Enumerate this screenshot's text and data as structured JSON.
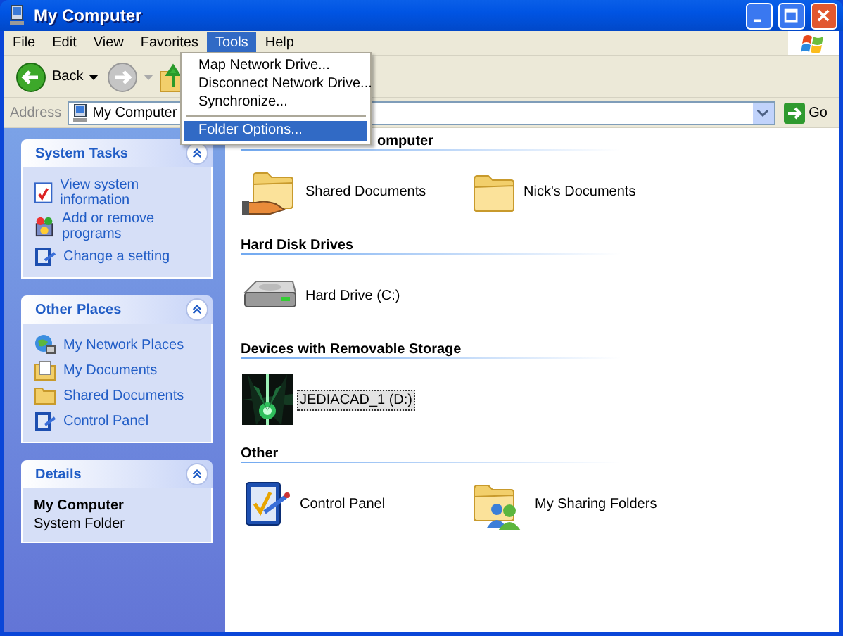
{
  "window": {
    "title": "My Computer"
  },
  "menu_bar": [
    {
      "label": "File",
      "selected": false
    },
    {
      "label": "Edit",
      "selected": false
    },
    {
      "label": "View",
      "selected": false
    },
    {
      "label": "Favorites",
      "selected": false
    },
    {
      "label": "Tools",
      "selected": true
    },
    {
      "label": "Help",
      "selected": false
    }
  ],
  "tools_menu": [
    {
      "kind": "item",
      "label": "Map Network Drive...",
      "selected": false
    },
    {
      "kind": "item",
      "label": "Disconnect Network Drive...",
      "selected": false
    },
    {
      "kind": "item",
      "label": "Synchronize...",
      "selected": false
    },
    {
      "kind": "separator"
    },
    {
      "kind": "item",
      "label": "Folder Options...",
      "selected": true
    }
  ],
  "toolbar": {
    "back": "Back"
  },
  "address_bar": {
    "label": "Address",
    "value": "My Computer",
    "go": "Go"
  },
  "task_panes": [
    {
      "kind": "links",
      "title": "System Tasks",
      "items": [
        {
          "label": "View system information",
          "kind": "info"
        },
        {
          "label": "Add or remove programs",
          "kind": "programs"
        },
        {
          "label": "Change a setting",
          "kind": "setting"
        }
      ]
    },
    {
      "kind": "links",
      "title": "Other Places",
      "items": [
        {
          "label": "My Network Places",
          "kind": "network"
        },
        {
          "label": "My Documents",
          "kind": "documents"
        },
        {
          "label": "Shared Documents",
          "kind": "folder"
        },
        {
          "label": "Control Panel",
          "kind": "setting"
        }
      ]
    },
    {
      "kind": "details",
      "title": "Details",
      "name": "My Computer",
      "description": "System Folder"
    }
  ],
  "groups": [
    {
      "title": "omputer",
      "items": [
        {
          "label": "Shared Documents",
          "kind": "shared-folder",
          "selected": false
        },
        {
          "label": "Nick's Documents",
          "kind": "folder",
          "selected": false
        }
      ]
    },
    {
      "title": "Hard Disk Drives",
      "items": [
        {
          "label": "Hard Drive (C:)",
          "kind": "drive",
          "selected": false
        }
      ]
    },
    {
      "title": "Devices with Removable Storage",
      "items": [
        {
          "label": "JEDIACAD_1 (D:)",
          "kind": "picture",
          "selected": true
        }
      ]
    },
    {
      "title": "Other",
      "items": [
        {
          "label": "Control Panel",
          "kind": "control-panel",
          "selected": false
        },
        {
          "label": "My Sharing Folders",
          "kind": "sharing-folder",
          "selected": false
        }
      ]
    }
  ]
}
